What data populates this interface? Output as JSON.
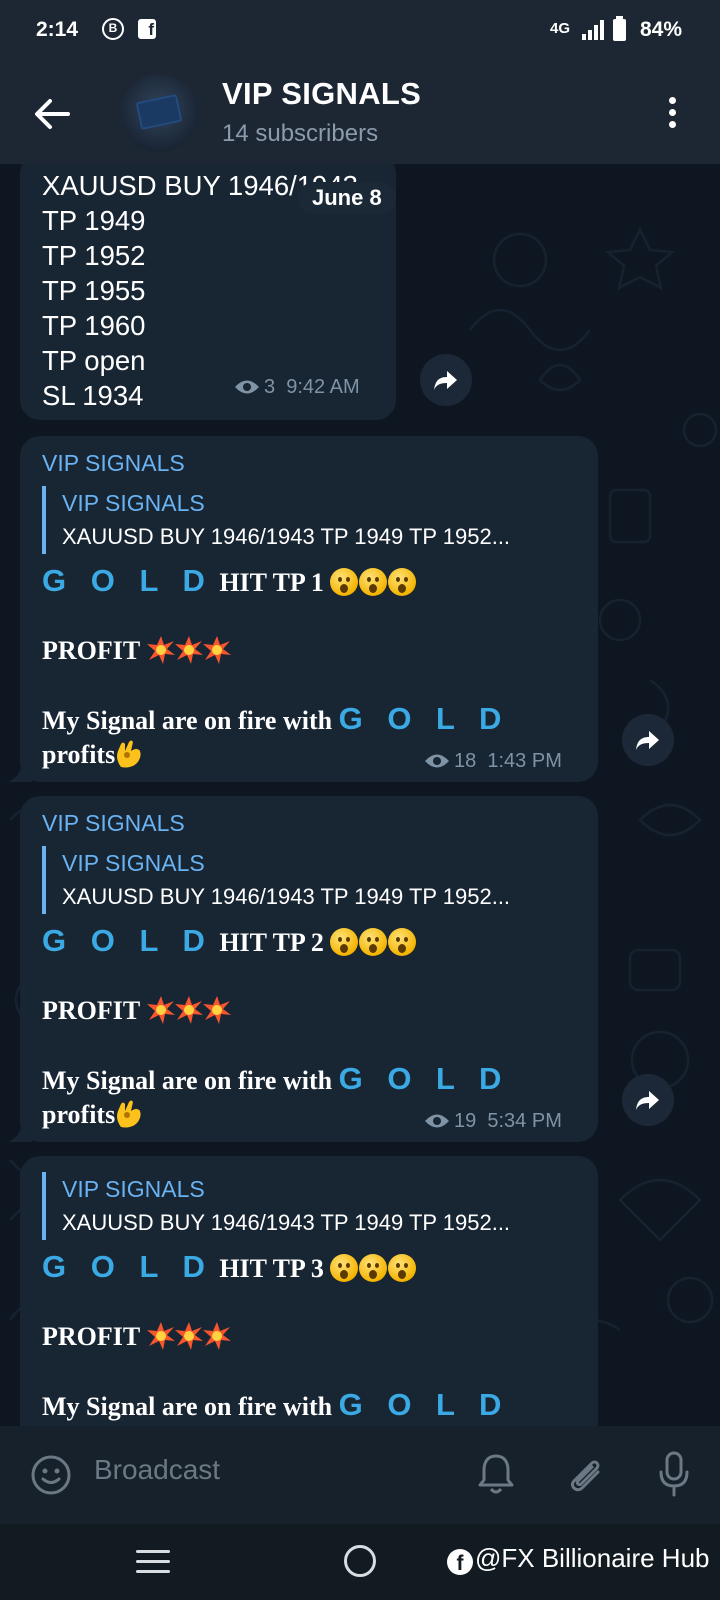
{
  "status_bar": {
    "time": "2:14",
    "b_icon_letter": "B",
    "network": "4G",
    "battery": "84%"
  },
  "header": {
    "title": "VIP SIGNALS",
    "subtitle": "14 subscribers"
  },
  "date_separator": "June 8",
  "messages": [
    {
      "lines": [
        "XAUUSD BUY 1946/1943",
        "TP 1949",
        "TP 1952",
        "TP 1955",
        "TP 1960",
        "TP open",
        "SL 1934"
      ],
      "views": "3",
      "time": "9:42 AM"
    },
    {
      "sender": "VIP SIGNALS",
      "reply_name": "VIP SIGNALS",
      "reply_text": "XAUUSD BUY 1946/1943 TP 1949 TP 1952...",
      "gold": "G O L D",
      "hit": "HIT TP 1",
      "profit": "PROFIT",
      "fire": "My Signal  are on fire with",
      "gold2": "G O L D",
      "profits": "profits",
      "views": "18",
      "time": "1:43 PM"
    },
    {
      "sender": "VIP SIGNALS",
      "reply_name": "VIP SIGNALS",
      "reply_text": "XAUUSD BUY 1946/1943 TP 1949 TP 1952...",
      "gold": "G O L D",
      "hit": "HIT TP 2",
      "profit": "PROFIT",
      "fire": "My Signal  are on fire with",
      "gold2": "G O L D",
      "profits": "profits",
      "views": "19",
      "time": "5:34 PM"
    },
    {
      "reply_name": "VIP SIGNALS",
      "reply_text": "XAUUSD BUY 1946/1943 TP 1949 TP 1952...",
      "gold": "G O L D",
      "hit": "HIT TP 3",
      "profit": "PROFIT",
      "fire": "My Signal  are on fire with",
      "gold2": "G O L D"
    }
  ],
  "input_bar": {
    "placeholder": "Broadcast"
  },
  "watermark": "@FX Billionaire Hub",
  "colors": {
    "background": "#0e1621",
    "header": "#1d2733",
    "bubble": "#182533",
    "accent": "#6ab3f3",
    "gold_text": "#3ba9e3",
    "meta": "#7f93a6"
  },
  "icons": [
    "back-arrow-icon",
    "more-vert-icon",
    "eye-icon",
    "forward-icon",
    "smile-icon",
    "bell-icon",
    "paperclip-icon",
    "mic-icon",
    "menu-icon",
    "home-icon",
    "facebook-icon"
  ]
}
